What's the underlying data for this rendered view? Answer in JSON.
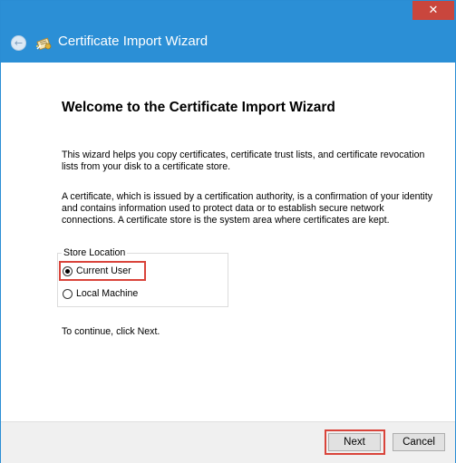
{
  "window": {
    "title": "Certificate Import Wizard",
    "close_glyph": "✕",
    "back_glyph": "←",
    "accent_color": "#2b8fd6",
    "close_color": "#c9463d",
    "highlight_color": "#d9443b"
  },
  "content": {
    "heading": "Welcome to the Certificate Import Wizard",
    "paragraph1": "This wizard helps you copy certificates, certificate trust lists, and certificate revocation lists from your disk to a certificate store.",
    "paragraph2": "A certificate, which is issued by a certification authority, is a confirmation of your identity and contains information used to protect data or to establish secure network connections. A certificate store is the system area where certificates are kept.",
    "store_location": {
      "legend": "Store Location",
      "options": [
        {
          "label": "Current User",
          "selected": true
        },
        {
          "label": "Local Machine",
          "selected": false
        }
      ]
    },
    "continue_text": "To continue, click Next."
  },
  "footer": {
    "next_label": "Next",
    "cancel_label": "Cancel"
  }
}
